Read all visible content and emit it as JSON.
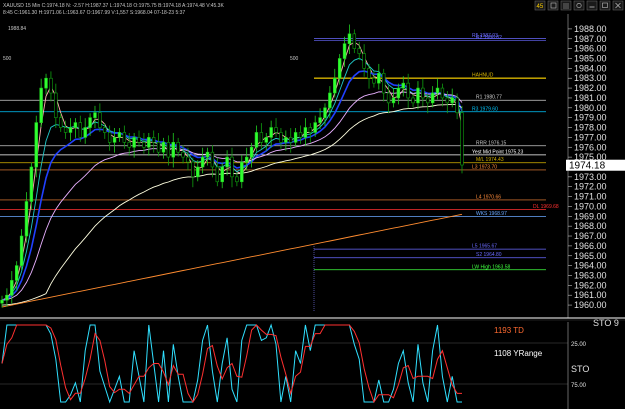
{
  "header": {
    "symbol_line": "XAUUSD 15 Min  C:1974.18  N: -2.57  H:1987.37  L:1974.18  O:1975.75  B:1974.18  A:1974.48  V:45.3K",
    "sub_line": "8:45  C:1961.30  H:1971.06  L:1963.67  O:1967.99  V:1,557  S:1968.04  07-18-23  5:37",
    "left_value": "1988.84",
    "marker_500": "500"
  },
  "toolbar": {
    "icons": [
      "45-icon",
      "copy-icon",
      "grid-icon",
      "settings-icon",
      "dash-icon",
      "restore-icon",
      "close-icon"
    ],
    "badge": "45"
  },
  "price_axis": {
    "ticks": [
      "1988.00",
      "1987.00",
      "1986.00",
      "1985.00",
      "1984.00",
      "1983.00",
      "1982.00",
      "1981.00",
      "1980.00",
      "1979.00",
      "1978.00",
      "1977.00",
      "1976.00",
      "1975.00",
      "1974.00",
      "1973.00",
      "1972.00",
      "1971.00",
      "1970.00",
      "1969.00",
      "1968.00",
      "1967.00",
      "1966.00",
      "1965.00",
      "1964.00",
      "1963.00",
      "1962.00",
      "1961.00",
      "1960.00"
    ],
    "last_price": "1974.18"
  },
  "levels": [
    {
      "label": "R5 1987.03",
      "price": 1987.03,
      "color": "#6a6aff"
    },
    {
      "label": "R2 1986.82",
      "price": 1986.82,
      "color": "#6a6aff"
    },
    {
      "label": "HAHNUD",
      "price": 1983.0,
      "color": "#d6b300"
    },
    {
      "label": "R1 1980.77",
      "price": 1980.77,
      "color": "#d0d0d0"
    },
    {
      "label": "R3 1979.60",
      "price": 1979.6,
      "color": "#00c8ff"
    },
    {
      "label": "RRR 1976.15",
      "price": 1976.15,
      "color": "#c8c8c8"
    },
    {
      "label": "Yest Mid Point 1975.23",
      "price": 1975.23,
      "color": "#ffffff"
    },
    {
      "label": "M/L 1974.43",
      "price": 1974.43,
      "color": "#d6b300"
    },
    {
      "label": "L3 1973.70",
      "price": 1973.7,
      "color": "#ff8c3c"
    },
    {
      "label": "L4 1970.66",
      "price": 1970.66,
      "color": "#ff8c3c"
    },
    {
      "label": "DL 1969.68",
      "price": 1969.68,
      "color": "#ff3030"
    },
    {
      "label": "WKS 1968.97",
      "price": 1968.97,
      "color": "#6aa8ff"
    },
    {
      "label": "L5 1965.67",
      "price": 1965.67,
      "color": "#6a6aff"
    },
    {
      "label": "S2 1964.80",
      "price": 1964.8,
      "color": "#6a6aff"
    },
    {
      "label": "LW High 1963.58",
      "price": 1963.58,
      "color": "#40ff40"
    }
  ],
  "oscillator": {
    "label": "STO",
    "axis_labels": [
      "STO 9",
      "25.00",
      "STO",
      "75.00"
    ],
    "annotation_td": "1193 TD",
    "annotation_range": "1108 YRange",
    "td_color": "#ff6a30"
  },
  "chart_data": {
    "type": "candlestick",
    "title": "XAUUSD 15 Min",
    "ylim": [
      1959.5,
      1988.7
    ],
    "close_path": [
      1960.5,
      1961,
      1962.5,
      1964,
      1967,
      1970.5,
      1974,
      1978.5,
      1982,
      1983,
      1981.5,
      1979,
      1978,
      1977.5,
      1978,
      1978.5,
      1977,
      1978,
      1979,
      1979.5,
      1978,
      1977.5,
      1976.5,
      1977,
      1977.5,
      1976.5,
      1976,
      1977,
      1976.5,
      1976,
      1977,
      1976.5,
      1975.5,
      1976.5,
      1975,
      1976.5,
      1975.5,
      1975,
      1974.5,
      1973,
      1974,
      1975,
      1975.5,
      1974,
      1972.5,
      1974,
      1975,
      1973,
      1972.5,
      1974.5,
      1975,
      1976,
      1977.5,
      1976.5,
      1977,
      1978,
      1977.5,
      1976.5,
      1977,
      1976.5,
      1977.5,
      1977,
      1978,
      1977.5,
      1978.5,
      1979,
      1980,
      1981.5,
      1983,
      1985,
      1986.5,
      1987.5,
      1986,
      1985.5,
      1984,
      1983,
      1982.5,
      1983.5,
      1981.5,
      1980.5,
      1981,
      1982,
      1982.5,
      1981,
      1980.5,
      1982,
      1981,
      1980.5,
      1981.5,
      1982,
      1981,
      1980.5,
      1981,
      1979.5,
      1974.2
    ],
    "series": [
      {
        "name": "MA pink",
        "color": "#ffb0b0"
      },
      {
        "name": "MA cyan",
        "color": "#20c8c8"
      },
      {
        "name": "MA blue",
        "color": "#2040ff"
      },
      {
        "name": "MA violet",
        "color": "#e8b0ff"
      },
      {
        "name": "MA white",
        "color": "#ffffe0"
      },
      {
        "name": "MA orange",
        "color": "#ff8c30"
      }
    ],
    "oscillator_series": [
      {
        "name": "fast",
        "color": "#30e0ff"
      },
      {
        "name": "slow",
        "color": "#ff3030"
      }
    ],
    "oscillator_ylim": [
      0,
      100
    ]
  }
}
